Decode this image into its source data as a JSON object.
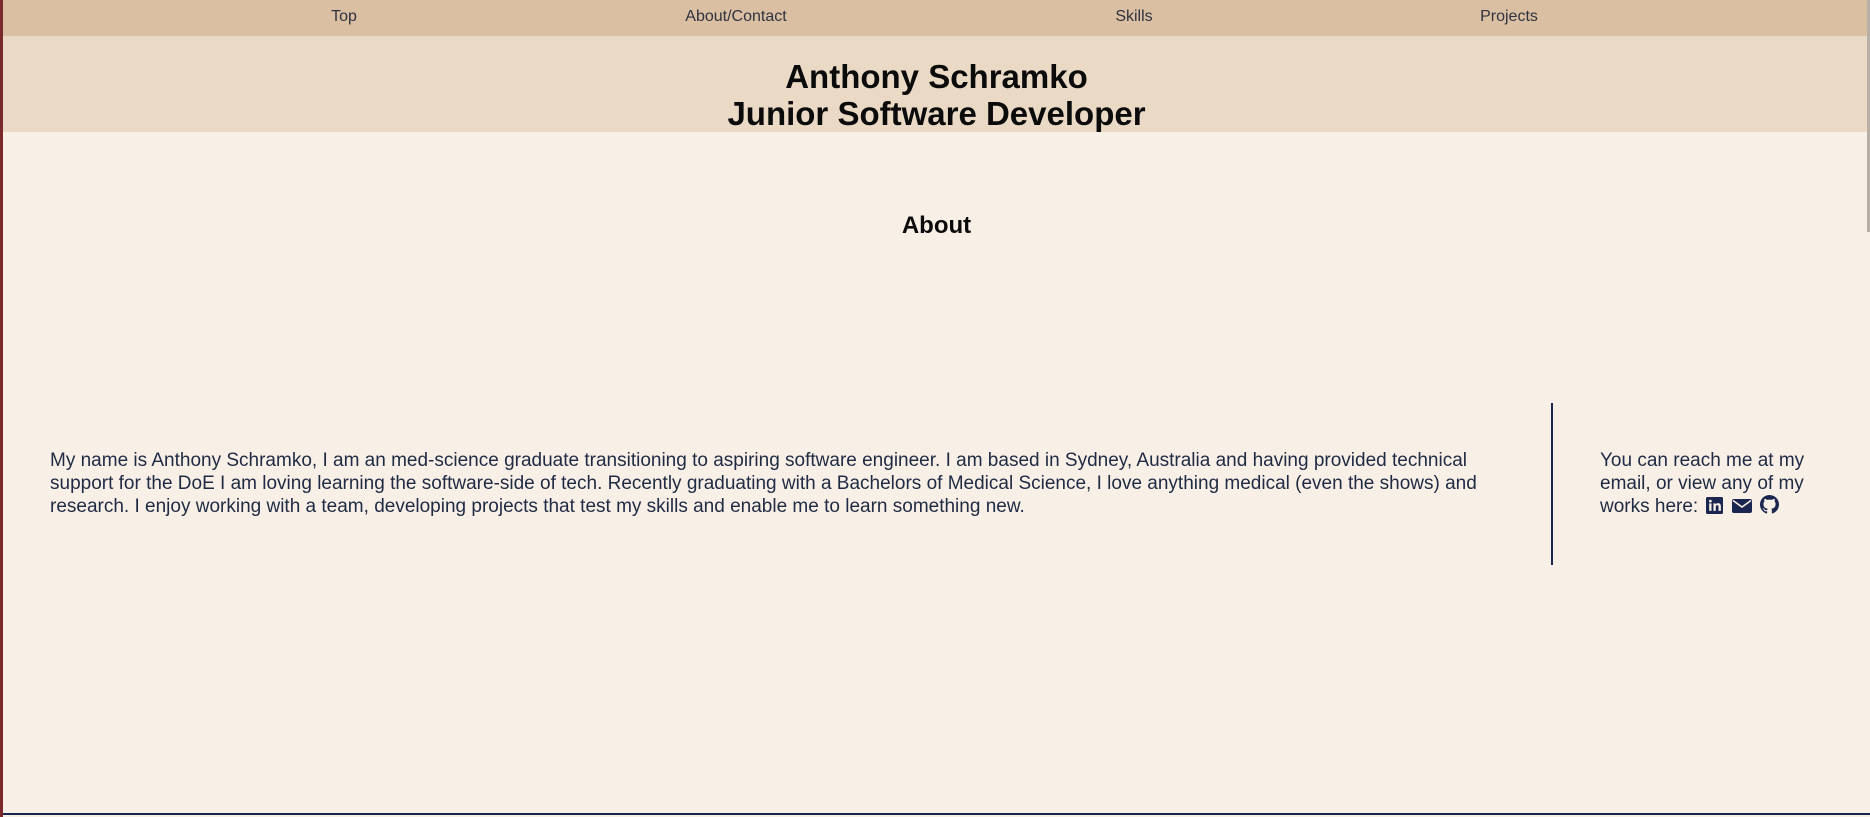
{
  "nav": {
    "items": [
      {
        "label": "Top"
      },
      {
        "label": "About/Contact"
      },
      {
        "label": "Skills"
      },
      {
        "label": "Projects"
      }
    ]
  },
  "header": {
    "name": "Anthony Schramko",
    "role": "Junior Software Developer"
  },
  "about": {
    "title": "About",
    "text": "My name is Anthony Schramko, I am an med-science graduate transitioning to aspiring software engineer. I am based in Sydney, Australia and having provided technical support for the DoE I am loving learning the software-side of tech. Recently graduating with a Bachelors of Medical Science, I love anything medical (even the shows) and research. I enjoy working with a team, developing projects that test my skills and enable me to learn something new."
  },
  "contact": {
    "text": "You can reach me at my email, or view any of my works here:",
    "icons": [
      "linkedin-icon",
      "email-icon",
      "github-icon"
    ]
  },
  "colors": {
    "nav_bg": "#dbbfa2",
    "header_bg": "#e9d9c5",
    "page_bg": "#f8efe6",
    "accent": "#1a2550"
  }
}
